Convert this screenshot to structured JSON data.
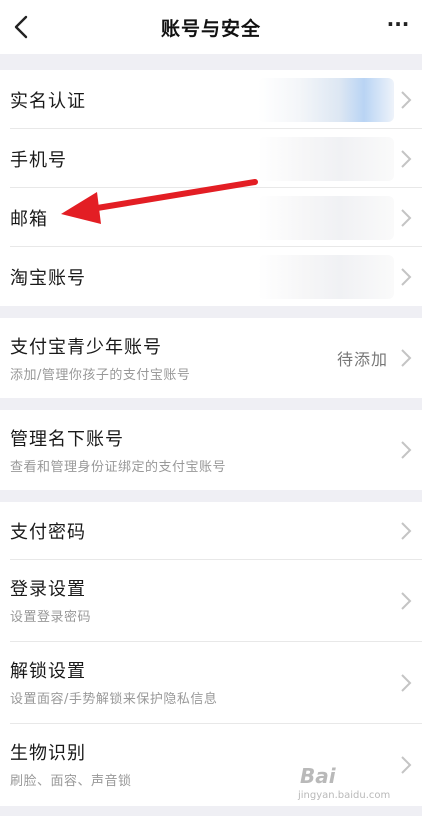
{
  "header": {
    "title": "账号与安全",
    "back_icon": "chevron-left-icon",
    "more_label": "···"
  },
  "groups": [
    {
      "items": [
        {
          "label": "实名认证"
        },
        {
          "label": "手机号"
        },
        {
          "label": "邮箱"
        },
        {
          "label": "淘宝账号"
        }
      ]
    },
    {
      "items": [
        {
          "label": "支付宝青少年账号",
          "subtitle": "添加/管理你孩子的支付宝账号",
          "value": "待添加"
        }
      ]
    },
    {
      "items": [
        {
          "label": "管理名下账号",
          "subtitle": "查看和管理身份证绑定的支付宝账号"
        }
      ]
    },
    {
      "items": [
        {
          "label": "支付密码"
        },
        {
          "label": "登录设置",
          "subtitle": "设置登录密码"
        },
        {
          "label": "解锁设置",
          "subtitle": "设置面容/手势解锁来保护隐私信息"
        },
        {
          "label": "生物识别",
          "subtitle": "刷脸、面容、声音锁"
        }
      ]
    }
  ],
  "annotation": {
    "arrow_color": "#e31e24",
    "target": "邮箱"
  },
  "watermark": {
    "brand": "Bai",
    "sub": "jingyan.baidu.com"
  },
  "colors": {
    "background": "#efeff4",
    "card": "#ffffff",
    "chevron": "#c4c4c4"
  }
}
